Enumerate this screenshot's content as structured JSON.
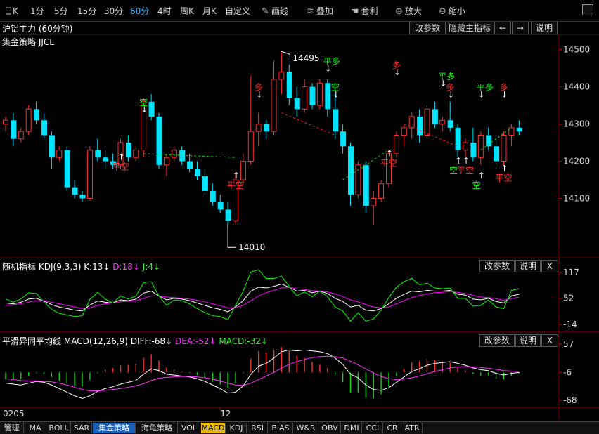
{
  "toolbar": {
    "periods": [
      "日K",
      "1分",
      "5分",
      "15分",
      "30分",
      "60分",
      "4时",
      "周K",
      "月K",
      "自定义"
    ],
    "active_period": "60分",
    "tools": [
      {
        "label": "画线",
        "icon": "pen-icon"
      },
      {
        "label": "叠加",
        "icon": "stack-icon"
      },
      {
        "label": "套利",
        "icon": "hand-icon"
      },
      {
        "label": "放大",
        "icon": "zoom-in-icon"
      },
      {
        "label": "缩小",
        "icon": "zoom-out-icon"
      }
    ]
  },
  "main_panel": {
    "title": "沪铝主力 (60分钟)",
    "buttons": [
      "改参数",
      "隐藏主指标",
      "←",
      "→",
      "说明"
    ],
    "strategy": "集金策略 JJCL",
    "annotations": {
      "high": "14495",
      "low": "14010"
    },
    "signals": {
      "long": "多",
      "short": "空",
      "close_long": "平多",
      "close_short": "平空"
    }
  },
  "kdj_panel": {
    "name": "随机指标",
    "params": "KDJ(9,3,3)",
    "k": "K:13↓",
    "d": "D:18↓",
    "j": "J:4↓",
    "buttons": [
      "改参数",
      "说明",
      "X"
    ]
  },
  "macd_panel": {
    "name": "平滑异同平均线",
    "params": "MACD(12,26,9)",
    "diff": "DIFF:-68↓",
    "dea": "DEA:-52↓",
    "macd": "MACD:-32↓",
    "buttons": [
      "改参数",
      "说明",
      "X"
    ]
  },
  "x_axis": {
    "labels": [
      "0205",
      "12"
    ]
  },
  "bottom_tabs": [
    "管理",
    "MA",
    "BOLL",
    "SAR",
    "集金策略",
    "海龟策略",
    "VOL",
    "MACD",
    "KDJ",
    "RSI",
    "BIAS",
    "W&R",
    "OBV",
    "DMI",
    "CCI",
    "CR",
    "ATR"
  ],
  "active_tabs": [
    "集金策略",
    "MACD"
  ],
  "colors": {
    "up": "#ff3030",
    "down": "#00e5ff",
    "k_line": "#ffffff",
    "d_line": "#ff00ff",
    "j_line": "#00ff00",
    "accent": "#3db8ff"
  },
  "chart_data": [
    {
      "type": "candlestick",
      "title": "沪铝主力 (60分钟)",
      "ylim": [
        13950,
        14520
      ],
      "y_ticks": [
        14500,
        14400,
        14300,
        14200,
        14100
      ],
      "candles": [
        [
          14300,
          14320,
          14280,
          14310
        ],
        [
          14310,
          14330,
          14240,
          14260
        ],
        [
          14260,
          14290,
          14250,
          14280
        ],
        [
          14280,
          14350,
          14270,
          14340
        ],
        [
          14340,
          14360,
          14300,
          14310
        ],
        [
          14310,
          14330,
          14260,
          14270
        ],
        [
          14270,
          14280,
          14180,
          14210
        ],
        [
          14210,
          14240,
          14200,
          14230
        ],
        [
          14230,
          14240,
          14120,
          14130
        ],
        [
          14130,
          14150,
          14100,
          14110
        ],
        [
          14110,
          14120,
          14090,
          14100
        ],
        [
          14100,
          14240,
          14095,
          14230
        ],
        [
          14230,
          14260,
          14200,
          14210
        ],
        [
          14210,
          14230,
          14180,
          14200
        ],
        [
          14200,
          14220,
          14180,
          14190
        ],
        [
          14190,
          14260,
          14180,
          14250
        ],
        [
          14250,
          14270,
          14200,
          14210
        ],
        [
          14210,
          14240,
          14200,
          14230
        ],
        [
          14230,
          14370,
          14210,
          14360
        ],
        [
          14360,
          14380,
          14310,
          14320
        ],
        [
          14320,
          14330,
          14180,
          14190
        ],
        [
          14190,
          14220,
          14160,
          14210
        ],
        [
          14210,
          14240,
          14200,
          14230
        ],
        [
          14230,
          14240,
          14190,
          14200
        ],
        [
          14200,
          14220,
          14170,
          14180
        ],
        [
          14180,
          14200,
          14150,
          14160
        ],
        [
          14160,
          14180,
          14110,
          14120
        ],
        [
          14120,
          14140,
          14080,
          14090
        ],
        [
          14090,
          14110,
          14060,
          14070
        ],
        [
          14070,
          14090,
          14020,
          14040
        ],
        [
          14040,
          14170,
          14030,
          14150
        ],
        [
          14150,
          14220,
          14140,
          14200
        ],
        [
          14200,
          14430,
          14190,
          14280
        ],
        [
          14280,
          14330,
          14240,
          14300
        ],
        [
          14300,
          14310,
          14260,
          14280
        ],
        [
          14280,
          14470,
          14270,
          14420
        ],
        [
          14420,
          14495,
          14380,
          14440
        ],
        [
          14440,
          14460,
          14350,
          14370
        ],
        [
          14370,
          14400,
          14320,
          14340
        ],
        [
          14340,
          14420,
          14330,
          14400
        ],
        [
          14400,
          14410,
          14340,
          14350
        ],
        [
          14350,
          14420,
          14340,
          14410
        ],
        [
          14410,
          14420,
          14320,
          14340
        ],
        [
          14340,
          14380,
          14260,
          14280
        ],
        [
          14280,
          14300,
          14220,
          14240
        ],
        [
          14240,
          14250,
          14080,
          14110
        ],
        [
          14110,
          14200,
          14100,
          14190
        ],
        [
          14190,
          14200,
          14060,
          14080
        ],
        [
          14080,
          14120,
          14030,
          14100
        ],
        [
          14100,
          14150,
          14090,
          14140
        ],
        [
          14140,
          14230,
          14130,
          14220
        ],
        [
          14220,
          14280,
          14210,
          14270
        ],
        [
          14270,
          14300,
          14240,
          14290
        ],
        [
          14290,
          14330,
          14260,
          14320
        ],
        [
          14320,
          14340,
          14250,
          14270
        ],
        [
          14270,
          14350,
          14260,
          14340
        ],
        [
          14340,
          14360,
          14290,
          14300
        ],
        [
          14300,
          14320,
          14280,
          14310
        ],
        [
          14310,
          14360,
          14280,
          14290
        ],
        [
          14290,
          14300,
          14210,
          14230
        ],
        [
          14230,
          14260,
          14210,
          14250
        ],
        [
          14250,
          14290,
          14200,
          14210
        ],
        [
          14210,
          14280,
          14190,
          14270
        ],
        [
          14270,
          14290,
          14230,
          14240
        ],
        [
          14240,
          14260,
          14190,
          14200
        ],
        [
          14200,
          14280,
          14190,
          14270
        ],
        [
          14270,
          14300,
          14240,
          14290
        ],
        [
          14290,
          14310,
          14270,
          14280
        ]
      ]
    },
    {
      "type": "line",
      "title": "KDJ(9,3,3)",
      "ylim": [
        -14,
        117
      ],
      "y_ticks": [
        117,
        52,
        -14
      ],
      "series": [
        {
          "name": "K",
          "values": [
            40,
            38,
            42,
            50,
            52,
            45,
            36,
            30,
            26,
            22,
            20,
            35,
            45,
            42,
            40,
            48,
            46,
            50,
            65,
            70,
            58,
            48,
            52,
            50,
            46,
            40,
            34,
            28,
            24,
            18,
            30,
            46,
            70,
            80,
            78,
            82,
            88,
            80,
            70,
            72,
            66,
            70,
            64,
            52,
            44,
            30,
            34,
            22,
            20,
            26,
            38,
            52,
            62,
            70,
            68,
            72,
            70,
            70,
            72,
            62,
            60,
            50,
            48,
            52,
            44,
            40,
            58,
            62
          ]
        },
        {
          "name": "D",
          "values": [
            35,
            36,
            38,
            42,
            46,
            46,
            42,
            38,
            34,
            30,
            26,
            28,
            34,
            38,
            40,
            43,
            44,
            46,
            52,
            58,
            58,
            55,
            54,
            52,
            50,
            47,
            43,
            38,
            33,
            28,
            28,
            34,
            46,
            58,
            66,
            72,
            78,
            79,
            76,
            74,
            71,
            70,
            68,
            63,
            56,
            48,
            43,
            36,
            30,
            28,
            30,
            38,
            46,
            54,
            59,
            63,
            66,
            67,
            69,
            67,
            64,
            59,
            55,
            54,
            51,
            47,
            51,
            55
          ]
        },
        {
          "name": "J",
          "values": [
            50,
            42,
            50,
            66,
            64,
            43,
            24,
            14,
            10,
            6,
            8,
            49,
            67,
            50,
            40,
            58,
            50,
            58,
            91,
            94,
            58,
            34,
            48,
            46,
            38,
            26,
            16,
            8,
            6,
            -2,
            34,
            70,
            118,
            124,
            102,
            102,
            108,
            82,
            58,
            68,
            56,
            70,
            56,
            30,
            20,
            -6,
            16,
            -6,
            0,
            22,
            54,
            80,
            94,
            102,
            86,
            90,
            78,
            76,
            78,
            52,
            52,
            32,
            34,
            48,
            30,
            26,
            72,
            76
          ]
        }
      ]
    },
    {
      "type": "bar",
      "title": "MACD(12,26,9)",
      "ylim": [
        -68,
        57
      ],
      "y_ticks": [
        57,
        -6,
        -68
      ],
      "series": [
        {
          "name": "DIFF",
          "values": [
            -30,
            -32,
            -34,
            -30,
            -26,
            -28,
            -34,
            -42,
            -50,
            -58,
            -64,
            -58,
            -48,
            -42,
            -38,
            -32,
            -28,
            -24,
            -10,
            2,
            -2,
            -10,
            -12,
            -14,
            -16,
            -20,
            -26,
            -34,
            -42,
            -52,
            -50,
            -36,
            -10,
            8,
            14,
            26,
            40,
            44,
            42,
            44,
            42,
            40,
            36,
            26,
            12,
            -10,
            -18,
            -34,
            -44,
            -46,
            -40,
            -28,
            -16,
            -4,
            2,
            10,
            14,
            16,
            18,
            14,
            10,
            4,
            0,
            -2,
            -8,
            -12,
            -8,
            -6
          ]
        },
        {
          "name": "DEA",
          "values": [
            -20,
            -22,
            -24,
            -25,
            -25,
            -26,
            -27,
            -30,
            -34,
            -39,
            -44,
            -47,
            -47,
            -46,
            -44,
            -42,
            -39,
            -36,
            -31,
            -24,
            -19,
            -17,
            -16,
            -15,
            -15,
            -16,
            -18,
            -21,
            -25,
            -30,
            -34,
            -35,
            -30,
            -22,
            -14,
            -6,
            4,
            12,
            18,
            23,
            27,
            29,
            30,
            29,
            26,
            19,
            11,
            2,
            -7,
            -15,
            -20,
            -22,
            -21,
            -18,
            -14,
            -9,
            -4,
            0,
            4,
            6,
            7,
            6,
            5,
            3,
            1,
            -2,
            -3,
            -4
          ]
        },
        {
          "name": "MACD",
          "values": [
            -20,
            -20,
            -20,
            -10,
            -2,
            -4,
            -14,
            -24,
            -32,
            -38,
            -40,
            -22,
            -2,
            8,
            12,
            20,
            22,
            24,
            42,
            52,
            34,
            14,
            8,
            2,
            -2,
            -8,
            -16,
            -26,
            -34,
            -44,
            -32,
            -2,
            40,
            60,
            56,
            64,
            72,
            64,
            48,
            42,
            30,
            22,
            12,
            -6,
            -28,
            -58,
            -58,
            -72,
            -74,
            -62,
            -40,
            -12,
            10,
            28,
            32,
            38,
            36,
            32,
            28,
            16,
            6,
            -4,
            -10,
            -10,
            -18,
            -20,
            -10,
            -4
          ]
        }
      ]
    }
  ]
}
